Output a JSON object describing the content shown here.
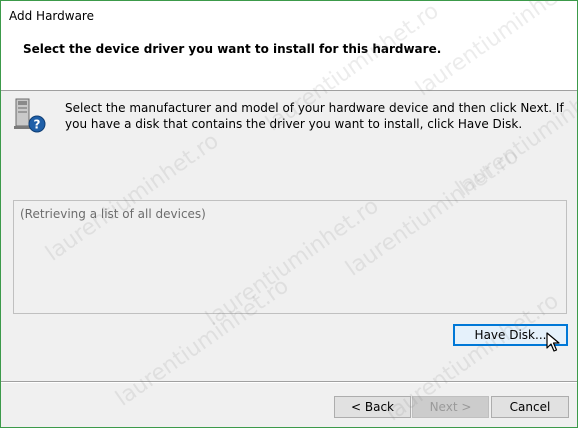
{
  "window": {
    "title": "Add Hardware"
  },
  "header": {
    "title": "Select the device driver you want to install for this hardware."
  },
  "body": {
    "instructions": "Select the manufacturer and model of your hardware device and then click Next. If you have a disk that contains the driver you want to install, click Have Disk.",
    "device_list_status": "(Retrieving a list of all devices)"
  },
  "buttons": {
    "have_disk": "Have Disk...",
    "back": "< Back",
    "next": "Next >",
    "cancel": "Cancel"
  },
  "watermark": {
    "text": "laurentiuminhet.ro"
  },
  "icons": {
    "hardware": "hardware-question-icon",
    "cursor": "mouse-pointer-icon"
  },
  "colors": {
    "accent": "#0078d7",
    "frame": "#3c9a4a",
    "background": "#f0f0f0"
  }
}
